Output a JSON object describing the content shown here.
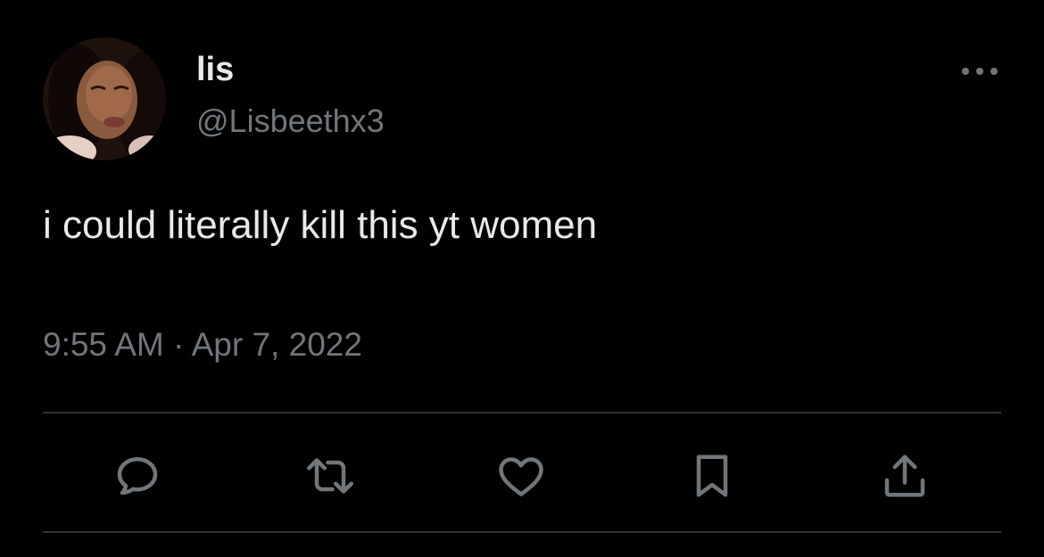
{
  "author": {
    "display_name": "lis",
    "handle": "@Lisbeethx3"
  },
  "tweet": {
    "text": "i could literally kill this yt women",
    "time": "9:55 AM",
    "separator": "·",
    "date": "Apr 7, 2022"
  },
  "icons": {
    "more": "more-horizontal-icon",
    "reply": "reply-icon",
    "retweet": "retweet-icon",
    "like": "heart-icon",
    "bookmark": "bookmark-icon",
    "share": "share-icon"
  },
  "colors": {
    "background": "#000000",
    "primary_text": "#e7e9ea",
    "secondary_text": "#71767b",
    "divider": "#2f3336"
  }
}
